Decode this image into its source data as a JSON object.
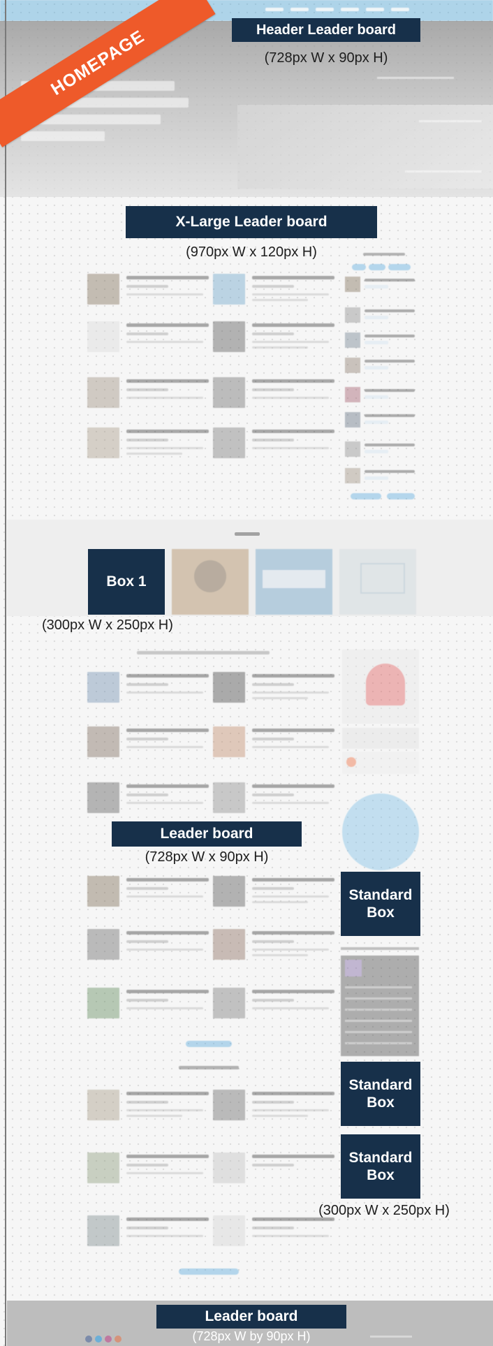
{
  "ribbon": {
    "label": "HOMEPAGE"
  },
  "ads": {
    "header": {
      "label": "Header Leader board",
      "size": "(728px W x 90px H)"
    },
    "xlarge": {
      "label": "X-Large Leader board",
      "size": "(970px W x 120px H)"
    },
    "box1": {
      "label": "Box 1",
      "size": "(300px W x 250px H)"
    },
    "leader_mid": {
      "label": "Leader board",
      "size": "(728px W x 90px H)"
    },
    "standard1": {
      "label": "Standard Box"
    },
    "standard2": {
      "label": "Standard Box"
    },
    "standard3": {
      "label": "Standard Box",
      "size": "(300px W x 250px H)"
    },
    "footer": {
      "label": "Leader board",
      "size": "(728px W by 90px H)"
    }
  },
  "colors": {
    "ad_fill": "#17304a",
    "ribbon": "#ee5a2a",
    "accent": "#4da6d8"
  }
}
